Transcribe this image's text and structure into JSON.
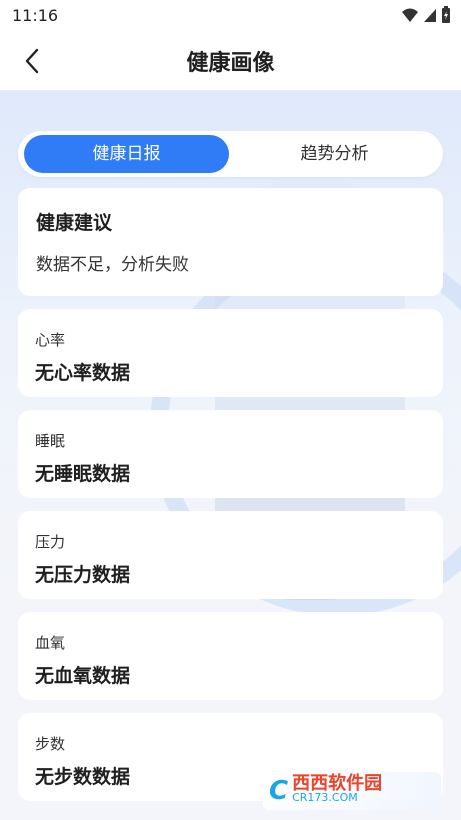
{
  "status_bar": {
    "time": "11:16"
  },
  "header": {
    "title": "健康画像"
  },
  "tabs": [
    {
      "label": "健康日报",
      "active": true
    },
    {
      "label": "趋势分析",
      "active": false
    }
  ],
  "advice": {
    "title": "健康建议",
    "text": "数据不足，分析失败"
  },
  "metrics": [
    {
      "label": "心率",
      "value": "无心率数据"
    },
    {
      "label": "睡眠",
      "value": "无睡眠数据"
    },
    {
      "label": "压力",
      "value": "无压力数据"
    },
    {
      "label": "血氧",
      "value": "无血氧数据"
    },
    {
      "label": "步数",
      "value": "无步数数据"
    }
  ],
  "watermark": {
    "brand": "西西软件园",
    "domain": "CR173.COM"
  },
  "colors": {
    "accent": "#2f7cf6",
    "background": "#f3f5fa"
  }
}
